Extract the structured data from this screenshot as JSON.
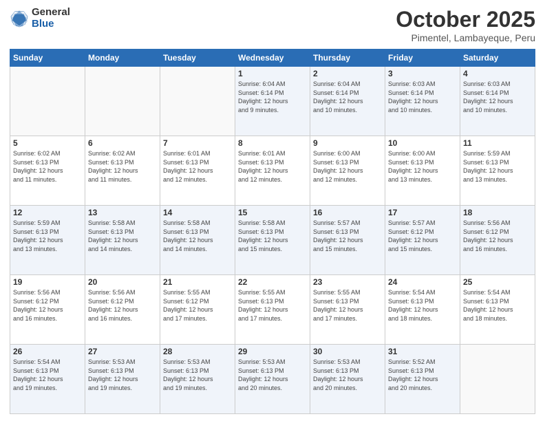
{
  "header": {
    "logo_general": "General",
    "logo_blue": "Blue",
    "month_title": "October 2025",
    "subtitle": "Pimentel, Lambayeque, Peru"
  },
  "weekdays": [
    "Sunday",
    "Monday",
    "Tuesday",
    "Wednesday",
    "Thursday",
    "Friday",
    "Saturday"
  ],
  "weeks": [
    [
      {
        "day": "",
        "info": ""
      },
      {
        "day": "",
        "info": ""
      },
      {
        "day": "",
        "info": ""
      },
      {
        "day": "1",
        "info": "Sunrise: 6:04 AM\nSunset: 6:14 PM\nDaylight: 12 hours\nand 9 minutes."
      },
      {
        "day": "2",
        "info": "Sunrise: 6:04 AM\nSunset: 6:14 PM\nDaylight: 12 hours\nand 10 minutes."
      },
      {
        "day": "3",
        "info": "Sunrise: 6:03 AM\nSunset: 6:14 PM\nDaylight: 12 hours\nand 10 minutes."
      },
      {
        "day": "4",
        "info": "Sunrise: 6:03 AM\nSunset: 6:14 PM\nDaylight: 12 hours\nand 10 minutes."
      }
    ],
    [
      {
        "day": "5",
        "info": "Sunrise: 6:02 AM\nSunset: 6:13 PM\nDaylight: 12 hours\nand 11 minutes."
      },
      {
        "day": "6",
        "info": "Sunrise: 6:02 AM\nSunset: 6:13 PM\nDaylight: 12 hours\nand 11 minutes."
      },
      {
        "day": "7",
        "info": "Sunrise: 6:01 AM\nSunset: 6:13 PM\nDaylight: 12 hours\nand 12 minutes."
      },
      {
        "day": "8",
        "info": "Sunrise: 6:01 AM\nSunset: 6:13 PM\nDaylight: 12 hours\nand 12 minutes."
      },
      {
        "day": "9",
        "info": "Sunrise: 6:00 AM\nSunset: 6:13 PM\nDaylight: 12 hours\nand 12 minutes."
      },
      {
        "day": "10",
        "info": "Sunrise: 6:00 AM\nSunset: 6:13 PM\nDaylight: 12 hours\nand 13 minutes."
      },
      {
        "day": "11",
        "info": "Sunrise: 5:59 AM\nSunset: 6:13 PM\nDaylight: 12 hours\nand 13 minutes."
      }
    ],
    [
      {
        "day": "12",
        "info": "Sunrise: 5:59 AM\nSunset: 6:13 PM\nDaylight: 12 hours\nand 13 minutes."
      },
      {
        "day": "13",
        "info": "Sunrise: 5:58 AM\nSunset: 6:13 PM\nDaylight: 12 hours\nand 14 minutes."
      },
      {
        "day": "14",
        "info": "Sunrise: 5:58 AM\nSunset: 6:13 PM\nDaylight: 12 hours\nand 14 minutes."
      },
      {
        "day": "15",
        "info": "Sunrise: 5:58 AM\nSunset: 6:13 PM\nDaylight: 12 hours\nand 15 minutes."
      },
      {
        "day": "16",
        "info": "Sunrise: 5:57 AM\nSunset: 6:13 PM\nDaylight: 12 hours\nand 15 minutes."
      },
      {
        "day": "17",
        "info": "Sunrise: 5:57 AM\nSunset: 6:12 PM\nDaylight: 12 hours\nand 15 minutes."
      },
      {
        "day": "18",
        "info": "Sunrise: 5:56 AM\nSunset: 6:12 PM\nDaylight: 12 hours\nand 16 minutes."
      }
    ],
    [
      {
        "day": "19",
        "info": "Sunrise: 5:56 AM\nSunset: 6:12 PM\nDaylight: 12 hours\nand 16 minutes."
      },
      {
        "day": "20",
        "info": "Sunrise: 5:56 AM\nSunset: 6:12 PM\nDaylight: 12 hours\nand 16 minutes."
      },
      {
        "day": "21",
        "info": "Sunrise: 5:55 AM\nSunset: 6:12 PM\nDaylight: 12 hours\nand 17 minutes."
      },
      {
        "day": "22",
        "info": "Sunrise: 5:55 AM\nSunset: 6:13 PM\nDaylight: 12 hours\nand 17 minutes."
      },
      {
        "day": "23",
        "info": "Sunrise: 5:55 AM\nSunset: 6:13 PM\nDaylight: 12 hours\nand 17 minutes."
      },
      {
        "day": "24",
        "info": "Sunrise: 5:54 AM\nSunset: 6:13 PM\nDaylight: 12 hours\nand 18 minutes."
      },
      {
        "day": "25",
        "info": "Sunrise: 5:54 AM\nSunset: 6:13 PM\nDaylight: 12 hours\nand 18 minutes."
      }
    ],
    [
      {
        "day": "26",
        "info": "Sunrise: 5:54 AM\nSunset: 6:13 PM\nDaylight: 12 hours\nand 19 minutes."
      },
      {
        "day": "27",
        "info": "Sunrise: 5:53 AM\nSunset: 6:13 PM\nDaylight: 12 hours\nand 19 minutes."
      },
      {
        "day": "28",
        "info": "Sunrise: 5:53 AM\nSunset: 6:13 PM\nDaylight: 12 hours\nand 19 minutes."
      },
      {
        "day": "29",
        "info": "Sunrise: 5:53 AM\nSunset: 6:13 PM\nDaylight: 12 hours\nand 20 minutes."
      },
      {
        "day": "30",
        "info": "Sunrise: 5:53 AM\nSunset: 6:13 PM\nDaylight: 12 hours\nand 20 minutes."
      },
      {
        "day": "31",
        "info": "Sunrise: 5:52 AM\nSunset: 6:13 PM\nDaylight: 12 hours\nand 20 minutes."
      },
      {
        "day": "",
        "info": ""
      }
    ]
  ]
}
